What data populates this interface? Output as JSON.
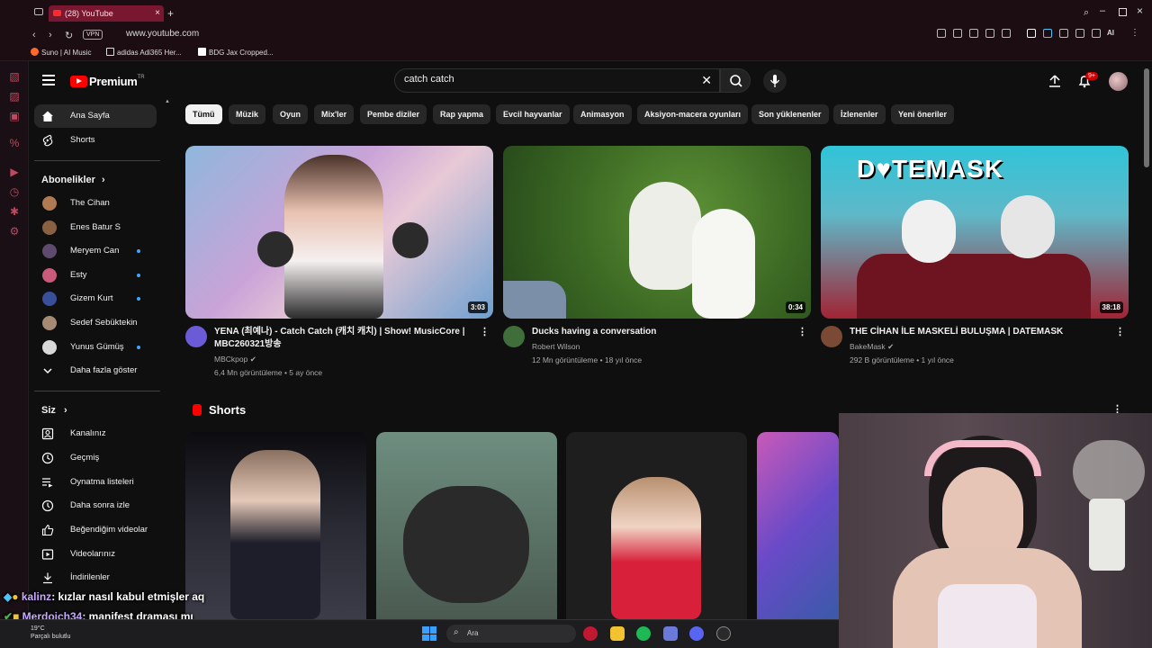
{
  "browser": {
    "tab_title": "(28) YouTube",
    "url": "www.youtube.com",
    "vpn_label": "VPN",
    "bookmarks": [
      "Suno | AI Music",
      "adidas Adi365 Her...",
      "BDG Jax Cropped..."
    ]
  },
  "youtube": {
    "logo_text": "Premium",
    "logo_region": "TR",
    "search": {
      "value": "catch catch"
    },
    "notifications_badge": "9+",
    "sidebar": {
      "main": [
        {
          "label": "Ana Sayfa",
          "icon": "home-icon"
        },
        {
          "label": "Shorts",
          "icon": "shorts-icon"
        }
      ],
      "subscriptions_title": "Abonelikler",
      "subscriptions": [
        {
          "label": "The Cihan",
          "dot": false,
          "color": "#b07a52"
        },
        {
          "label": "Enes Batur S",
          "dot": false,
          "color": "#8a6043"
        },
        {
          "label": "Meryem Can",
          "dot": true,
          "color": "#5d4a6e"
        },
        {
          "label": "Esty",
          "dot": true,
          "color": "#c95a7a"
        },
        {
          "label": "Gizem Kurt",
          "dot": true,
          "color": "#3a4f9a"
        },
        {
          "label": "Sedef Sebüktekin",
          "dot": false,
          "color": "#a68a73"
        },
        {
          "label": "Yunus Gümüş",
          "dot": true,
          "color": "#d8d8d8"
        }
      ],
      "show_more": "Daha fazla göster",
      "you_title": "Siz",
      "you_items": [
        {
          "label": "Kanalınız",
          "icon": "channel-icon"
        },
        {
          "label": "Geçmiş",
          "icon": "history-icon"
        },
        {
          "label": "Oynatma listeleri",
          "icon": "playlists-icon"
        },
        {
          "label": "Daha sonra izle",
          "icon": "watch-later-icon"
        },
        {
          "label": "Beğendiğim videolar",
          "icon": "liked-icon"
        },
        {
          "label": "Videolarınız",
          "icon": "your-videos-icon"
        },
        {
          "label": "İndirilenler",
          "icon": "download-icon"
        }
      ]
    },
    "chips": [
      "Tümü",
      "Müzik",
      "Oyun",
      "Mix'ler",
      "Pembe diziler",
      "Rap yapma",
      "Evcil hayvanlar",
      "Animasyon",
      "Aksiyon-macera oyunları",
      "Son yüklenenler",
      "İzlenenler",
      "Yeni öneriler"
    ],
    "videos": [
      {
        "title": "YENA (최예나) - Catch Catch (캐치 캐치) | Show! MusicCore | MBC260321방송",
        "channel": "MBCkpop",
        "stats": "6,4 Mn görüntüleme • 5 ay önce",
        "duration": "3:03",
        "verified": true,
        "colors": [
          "#8fb7dc",
          "#e8c9d6",
          "#2b2b2b"
        ]
      },
      {
        "title": "Ducks having a conversation",
        "channel": "Robert Wilson",
        "stats": "12 Mn görüntüleme • 18 yıl önce",
        "duration": "0:34",
        "verified": false,
        "colors": [
          "#4a7a2e",
          "#2f5a1f",
          "#f2f2ee"
        ]
      },
      {
        "title": "THE CİHAN İLE MASKELİ BULUŞMA | DATEMASK",
        "channel": "BakeMask",
        "stats": "292 B görüntüleme • 1 yıl önce",
        "duration": "38:18",
        "verified": true,
        "colors": [
          "#30c4d8",
          "#d2283c",
          "#111111"
        ]
      }
    ],
    "shorts_title": "Shorts",
    "shorts": [
      {
        "colors": [
          "#0c0c10",
          "#3c3c48"
        ]
      },
      {
        "colors": [
          "#6e8e80",
          "#2a2a2a"
        ]
      },
      {
        "colors": [
          "#222222",
          "#d8203a"
        ]
      },
      {
        "colors": [
          "#c85ab8",
          "#3a5aa8"
        ]
      }
    ]
  },
  "stream_overlay": {
    "chat": [
      {
        "user": "kalinz",
        "message": ": kızlar nasıl kabul etmişler aq"
      },
      {
        "user": "Merdoich34",
        "message": ": manifest draması mı"
      }
    ]
  },
  "taskbar": {
    "weather_temp": "19°C",
    "weather_desc": "Parçalı bulutlu",
    "search_label": "Ara"
  }
}
